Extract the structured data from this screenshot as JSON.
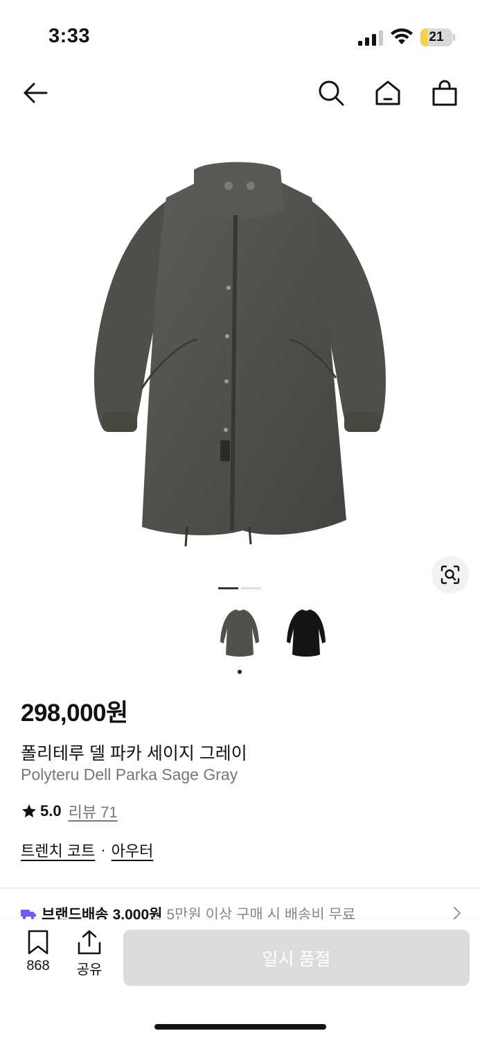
{
  "status_bar": {
    "time": "3:33",
    "battery_level": "21",
    "battery_fraction": 0.21,
    "battery_color": "#f7d13b"
  },
  "nav": {
    "icons": [
      "back-arrow-icon",
      "search-icon",
      "home-icon",
      "shopping-bag-icon"
    ]
  },
  "gallery": {
    "page_count": 2,
    "current_page": 1,
    "thumbnails": [
      {
        "color_name": "sage-gray",
        "color": "#4f524a"
      },
      {
        "color_name": "black",
        "color": "#141414"
      }
    ],
    "selected_thumbnail": 0
  },
  "product": {
    "price": "298,000원",
    "name_ko": "폴리테루 델 파카 세이지 그레이",
    "name_en": "Polyteru Dell Parka Sage Gray",
    "rating": "5.0",
    "review_label": "리뷰 71",
    "categories": [
      "트렌치 코트",
      "아우터"
    ],
    "category_separator": "·"
  },
  "delivery": {
    "label": "브랜드배송",
    "fee": "3,000원",
    "note": "5만원 이상 구매 시 배송비 무료",
    "icon": "delivery-truck-icon",
    "icon_color": "#6b5cf6"
  },
  "bottom_bar": {
    "bookmark_count": "868",
    "share_label": "공유",
    "primary_button": "일시 품절"
  }
}
